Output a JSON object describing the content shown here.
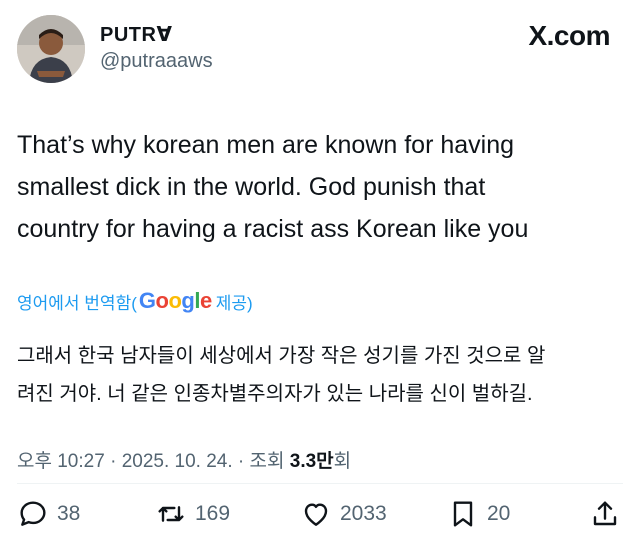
{
  "user": {
    "display_name": "PUTRⱯ",
    "handle": "@putraaaws"
  },
  "source_label": "X.com",
  "tweet": {
    "lines": [
      "That’s why korean men are known for having",
      "smallest dick in the world. God punish that",
      "country for having a racist ass Korean like you"
    ]
  },
  "translation": {
    "prefix": "영어에서 번역함(",
    "provider": "Google",
    "suffix": " 제공)",
    "lines": [
      "그래서 한국 남자들이 세상에서 가장 작은 성기를 가진 것으로 알",
      "려진 거야. 너 같은 인종차별주의자가 있는 나라를 신이 벌하길."
    ]
  },
  "meta": {
    "time": "오후 10:27",
    "sep1": " · ",
    "date": "2025. 10. 24.",
    "sep2": " · ",
    "views_label": "조회 ",
    "views_value": "3.3만",
    "views_suffix": "회"
  },
  "actions": {
    "replies": "38",
    "reposts": "169",
    "likes": "2033",
    "bookmarks": "20"
  },
  "icons": {
    "reply": "reply-icon",
    "repost": "repost-icon",
    "like": "heart-icon",
    "bookmark": "bookmark-icon",
    "share": "share-icon"
  },
  "colors": {
    "text": "#0f1419",
    "secondary": "#536471",
    "link": "#1d9bf0",
    "google_blue": "#4285f4",
    "google_red": "#ea4335",
    "google_yellow": "#fbbc05",
    "google_green": "#34a853"
  }
}
